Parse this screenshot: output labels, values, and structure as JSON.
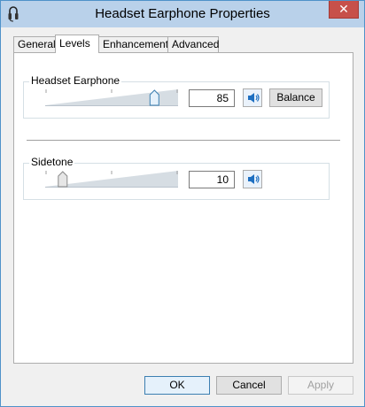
{
  "window": {
    "title": "Headset Earphone Properties",
    "close_label": "✕"
  },
  "tabs": [
    {
      "label": "General",
      "active": false
    },
    {
      "label": "Levels",
      "active": true
    },
    {
      "label": "Enhancements",
      "active": false
    },
    {
      "label": "Advanced",
      "active": false
    }
  ],
  "levels": {
    "headset": {
      "label": "Headset Earphone",
      "value": "85",
      "level": 0.85,
      "balance_label": "Balance"
    },
    "sidetone": {
      "label": "Sidetone",
      "value": "10",
      "level": 0.1
    }
  },
  "footer": {
    "ok_label": "OK",
    "cancel_label": "Cancel",
    "apply_label": "Apply"
  },
  "icons": {
    "app": "headset-icon",
    "speaker": "speaker-icon"
  },
  "colors": {
    "accent": "#3c7fb1",
    "titlebar": "#b9d1ea",
    "close": "#c7504a"
  }
}
